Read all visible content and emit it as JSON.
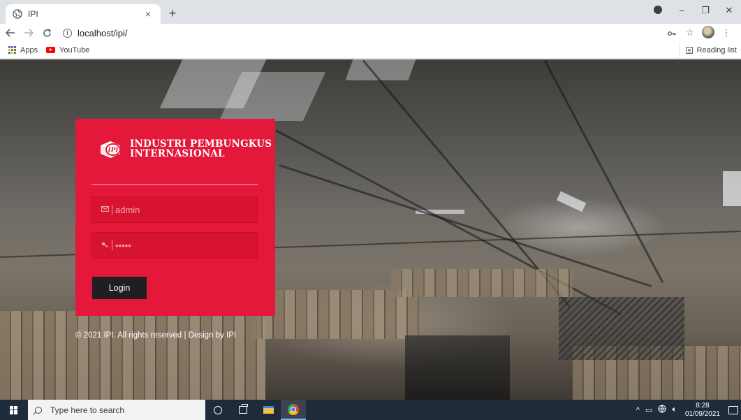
{
  "browser": {
    "tab_title": "IPI",
    "tab_close": "×",
    "new_tab": "+",
    "url": "localhost/ipi/",
    "bookmarks": [
      {
        "label": "Apps",
        "icon": "apps-grid-icon"
      },
      {
        "label": "YouTube",
        "icon": "youtube-icon"
      }
    ],
    "reading_list": "Reading list",
    "window_controls": {
      "minimize": "−",
      "maximize": "❐",
      "close": "✕"
    }
  },
  "login": {
    "brand_line1": "INDUSTRI PEMBUNGKUS",
    "brand_line2": "INTERNASIONAL",
    "logo_text": "IPI",
    "email_value": "admin",
    "password_value": "•••••",
    "login_label": "Login",
    "copyright": "© 2021 IPI. All rights reserved | Design by IPI"
  },
  "taskbar": {
    "search_placeholder": "Type here to search",
    "time": "8:28",
    "date": "01/09/2021"
  },
  "colors": {
    "card_red": "#e3183a",
    "button_dark": "#1f1f1f",
    "taskbar": "#1f2a3a"
  }
}
